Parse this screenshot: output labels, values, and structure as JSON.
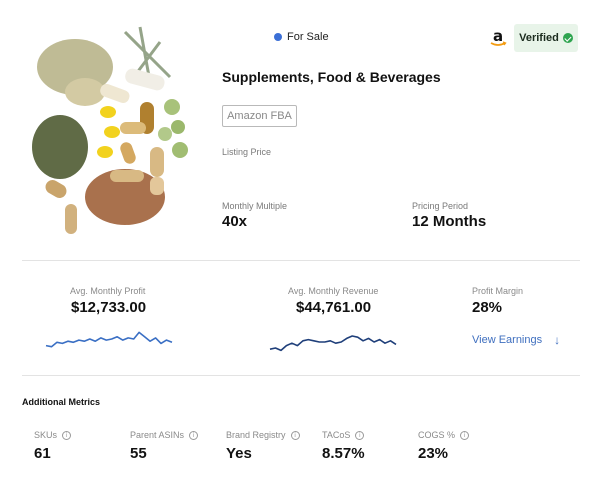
{
  "listing": {
    "status": "For Sale",
    "verified_label": "Verified",
    "category": "Supplements, Food & Beverages",
    "channel_tag": "Amazon FBA",
    "listing_price_label": "Listing Price",
    "monthly_multiple_label": "Monthly Multiple",
    "monthly_multiple_value": "40x",
    "pricing_period_label": "Pricing Period",
    "pricing_period_value": "12 Months"
  },
  "metrics": {
    "profit_label": "Avg. Monthly Profit",
    "profit_value": "$12,733.00",
    "revenue_label": "Avg. Monthly Revenue",
    "revenue_value": "$44,761.00",
    "margin_label": "Profit Margin",
    "margin_value": "28%",
    "view_earnings": "View Earnings",
    "profit_trend": [
      0.2,
      0.15,
      0.35,
      0.3,
      0.4,
      0.35,
      0.45,
      0.4,
      0.5,
      0.4,
      0.55,
      0.45,
      0.5,
      0.6,
      0.45,
      0.55,
      0.5,
      0.8,
      0.6,
      0.4,
      0.55,
      0.3,
      0.45,
      0.35
    ],
    "revenue_trend": [
      0.2,
      0.25,
      0.15,
      0.35,
      0.45,
      0.35,
      0.55,
      0.6,
      0.55,
      0.5,
      0.5,
      0.55,
      0.45,
      0.5,
      0.65,
      0.75,
      0.7,
      0.55,
      0.65,
      0.5,
      0.6,
      0.45,
      0.55,
      0.4
    ]
  },
  "additional": {
    "title": "Additional Metrics",
    "items": [
      {
        "label": "SKUs",
        "value": "61"
      },
      {
        "label": "Parent ASINs",
        "value": "55"
      },
      {
        "label": "Brand Registry",
        "value": "Yes"
      },
      {
        "label": "TACoS",
        "value": "8.57%"
      },
      {
        "label": "COGS %",
        "value": "23%"
      }
    ]
  },
  "colors": {
    "accent_blue": "#3b6fd6",
    "profit_line": "#3a6fc4",
    "revenue_line": "#1f3f7a",
    "verified_bg": "#e8f4e9",
    "verified_check": "#2ea44f"
  }
}
